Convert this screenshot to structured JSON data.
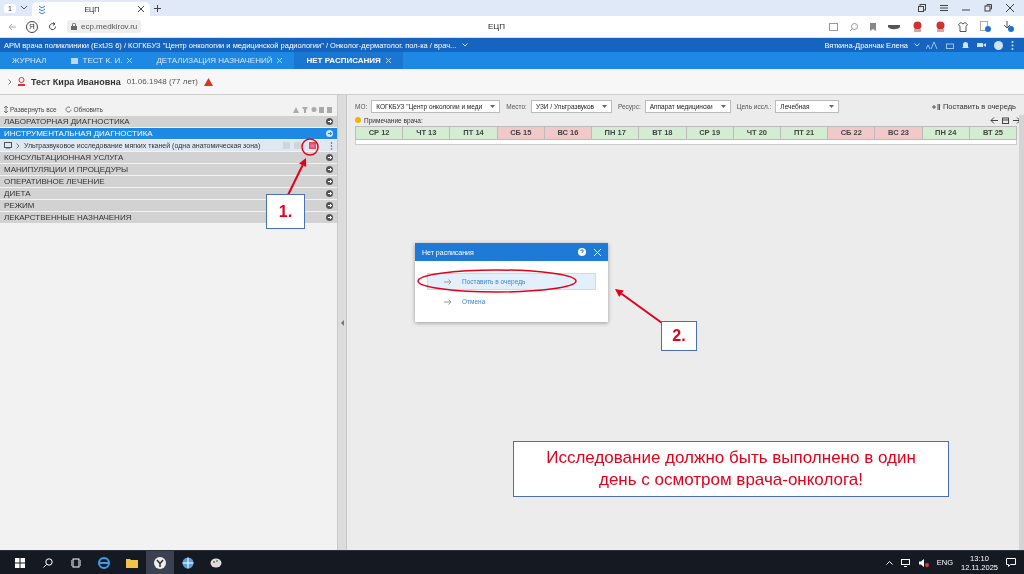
{
  "browser": {
    "tab_count": "1",
    "tabs": [
      {
        "title": "ЕЦП",
        "selected": true
      }
    ],
    "home_glyph": "Я",
    "url": "ecp.medkirov.ru",
    "page_title": "ЕЦП"
  },
  "app_header": {
    "breadcrumb": "АРМ врача поликлиники (ExtJS 6) / КОГКБУЗ \"Центр онкологии и медицинской радиологии\" / Онколог-дерматолог. пол-ка / врач...",
    "user": "Вяткина-Дранчак Елена"
  },
  "app_tabs": [
    {
      "label": "ЖУРНАЛ",
      "closable": false,
      "selected": false
    },
    {
      "label": "ТЕСТ К. И.",
      "closable": true,
      "selected": false
    },
    {
      "label": "ДЕТАЛИЗАЦИЯ НАЗНАЧЕНИЙ",
      "closable": true,
      "selected": false
    },
    {
      "label": "НЕТ РАСПИСАНИЯ",
      "closable": true,
      "selected": true
    }
  ],
  "patient": {
    "name": "Тест Кира Ивановна",
    "birth": "01.06.1948 (77 лет)"
  },
  "left_toolbar": [
    "Развернуть все",
    "Обновить"
  ],
  "categories": [
    {
      "label": "ЛАБОРАТОРНАЯ ДИАГНОСТИКА",
      "selected": false
    },
    {
      "label": "ИНСТРУМЕНТАЛЬНАЯ ДИАГНОСТИКА",
      "selected": true,
      "children": [
        {
          "label": "Ультразвуковое исследование мягких тканей (одна анатомическая зона)"
        }
      ]
    },
    {
      "label": "КОНСУЛЬТАЦИОННАЯ УСЛУГА",
      "selected": false
    },
    {
      "label": "МАНИПУЛЯЦИИ И ПРОЦЕДУРЫ",
      "selected": false
    },
    {
      "label": "ОПЕРАТИВНОЕ ЛЕЧЕНИЕ",
      "selected": false
    },
    {
      "label": "ДИЕТА",
      "selected": false
    },
    {
      "label": "РЕЖИМ",
      "selected": false
    },
    {
      "label": "ЛЕКАРСТВЕННЫЕ НАЗНАЧЕНИЯ",
      "selected": false
    }
  ],
  "filters": [
    {
      "label": "МО:",
      "value": "КОГКБУЗ \"Центр онкологии и меди"
    },
    {
      "label": "Место:",
      "value": "УЗИ / Ультразвуков"
    },
    {
      "label": "Ресурс:",
      "value": "Аппарат медицински"
    },
    {
      "label": "Цель иссл.:",
      "value": "Лечебная"
    }
  ],
  "queue_button": "Поставить в очередь",
  "doctor_note": "Примечание врача:",
  "days": [
    {
      "label": "СР 12",
      "weekend": false
    },
    {
      "label": "ЧТ 13",
      "weekend": false
    },
    {
      "label": "ПТ 14",
      "weekend": false
    },
    {
      "label": "СБ 15",
      "weekend": true
    },
    {
      "label": "ВС 16",
      "weekend": true
    },
    {
      "label": "ПН 17",
      "weekend": false
    },
    {
      "label": "ВТ 18",
      "weekend": false
    },
    {
      "label": "СР 19",
      "weekend": false
    },
    {
      "label": "ЧТ 20",
      "weekend": false
    },
    {
      "label": "ПТ 21",
      "weekend": false
    },
    {
      "label": "СБ 22",
      "weekend": true
    },
    {
      "label": "ВС 23",
      "weekend": true
    },
    {
      "label": "ПН 24",
      "weekend": false
    },
    {
      "label": "ВТ 25",
      "weekend": false
    }
  ],
  "dialog": {
    "title": "Нет расписания",
    "options": [
      {
        "label": "Поставить в очередь",
        "selected": true
      },
      {
        "label": "Отмена",
        "selected": false
      }
    ]
  },
  "annotations": {
    "callouts": [
      "1.",
      "2."
    ],
    "note": "Исследование должно быть выполнено в один день с осмотром врача-онколога!"
  },
  "taskbar": {
    "language": "ENG",
    "time": "13:10",
    "date": "12.11.2025"
  }
}
